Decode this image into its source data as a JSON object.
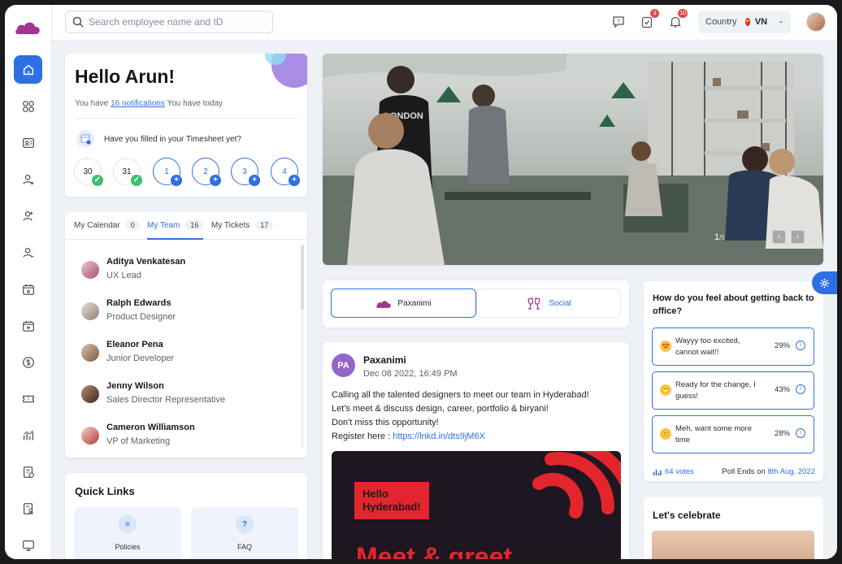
{
  "topbar": {
    "search_placeholder": "Search employee name and ID",
    "task_badge": "3",
    "bell_badge": "10",
    "country_label": "Country",
    "country_code": "VN"
  },
  "hello": {
    "greeting": "Hello Arun!",
    "notif_prefix": "You have",
    "notif_link": "16 notifications",
    "notif_suffix": "You have today",
    "timesheet_question": "Have you filled in your Timesheet yet?",
    "days": [
      {
        "label": "30",
        "status": "done"
      },
      {
        "label": "31",
        "status": "done"
      },
      {
        "label": "1",
        "status": "add"
      },
      {
        "label": "2",
        "status": "add"
      },
      {
        "label": "3",
        "status": "add"
      },
      {
        "label": "4",
        "status": "add"
      }
    ]
  },
  "team": {
    "tabs": [
      {
        "label": "My Calendar",
        "count": "0"
      },
      {
        "label": "My Team",
        "count": "16"
      },
      {
        "label": "My Tickets",
        "count": "17"
      }
    ],
    "members": [
      {
        "name": "Aditya Venkatesan",
        "role": "UX Lead"
      },
      {
        "name": "Ralph Edwards",
        "role": "Product Designer"
      },
      {
        "name": "Eleanor Pena",
        "role": "Junior Developer"
      },
      {
        "name": "Jenny Wilson",
        "role": "Sales Director Representative"
      },
      {
        "name": "Cameron Williamson",
        "role": "VP of Marketing"
      }
    ]
  },
  "quick_links": {
    "title": "Quick Links",
    "items": [
      {
        "label": "Policies"
      },
      {
        "label": "FAQ"
      }
    ]
  },
  "hero": {
    "page": "1",
    "total": "/5",
    "shirt_text": "LONDON"
  },
  "switcher": {
    "left": "Paxanimi",
    "right": "Social"
  },
  "post": {
    "initials": "PA",
    "author": "Paxanimi",
    "date": "Dec 08 2022, 16:49 PM",
    "line1": "Calling all the talented designers to meet our team in Hyderabad!",
    "line2": "Let's meet & discuss design, career, portfolio & biryani!",
    "line3": "Don't miss this opportunity!",
    "register_label": "Register here : ",
    "register_link": "https://lnkd.in/dts9jM6X",
    "promo_line1": "Hello",
    "promo_line2": "Hyderabad!",
    "promo_big": "Meet & greet"
  },
  "poll": {
    "question": "How do you feel about getting back to office?",
    "options": [
      {
        "text": "Wayyy too excited, cannot wait!!",
        "percent": "29%"
      },
      {
        "text": "Ready for the change, I guess!",
        "percent": "43%"
      },
      {
        "text": "Meh, want some more time",
        "percent": "28%"
      }
    ],
    "votes": "64 votes",
    "ends_prefix": "Poll Ends on ",
    "ends_date": "8th Aug, 2022"
  },
  "celebrate": {
    "title": "Let's celebrate"
  },
  "colors": {
    "accent": "#2f6fe4",
    "brand": "#9c2a8e",
    "success": "#3fbf6f",
    "danger": "#e5484d"
  }
}
